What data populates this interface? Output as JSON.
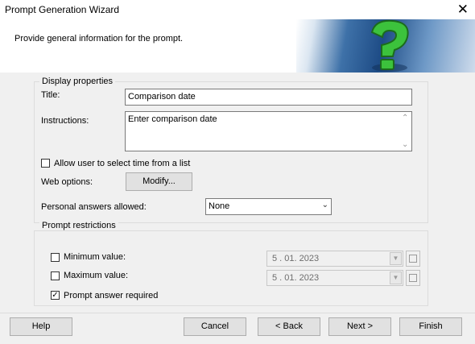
{
  "window": {
    "title": "Prompt Generation Wizard",
    "close_glyph": "✕"
  },
  "header": {
    "text": "Provide general information for the prompt.",
    "icon": "question-mark-icon"
  },
  "display_properties": {
    "legend": "Display properties",
    "title_label": "Title:",
    "title_value": "Comparison date",
    "instructions_label": "Instructions:",
    "instructions_value": "Enter comparison date",
    "allow_time_label": "Allow user to select time from a list",
    "allow_time_checked": false,
    "web_options_label": "Web options:",
    "modify_button": "Modify...",
    "personal_answers_label": "Personal answers allowed:",
    "personal_answers_value": "None"
  },
  "prompt_restrictions": {
    "legend": "Prompt restrictions",
    "minimum_label": "Minimum value:",
    "minimum_checked": false,
    "minimum_value": "5 . 01. 2023",
    "maximum_label": "Maximum value:",
    "maximum_checked": false,
    "maximum_value": "5 . 01. 2023",
    "required_label": "Prompt answer required",
    "required_checked": true
  },
  "buttons": {
    "help": "Help",
    "cancel": "Cancel",
    "back": "< Back",
    "next": "Next >",
    "finish": "Finish"
  },
  "colors": {
    "banner_blue": "#1e4c86",
    "icon_green": "#3cc23c"
  }
}
